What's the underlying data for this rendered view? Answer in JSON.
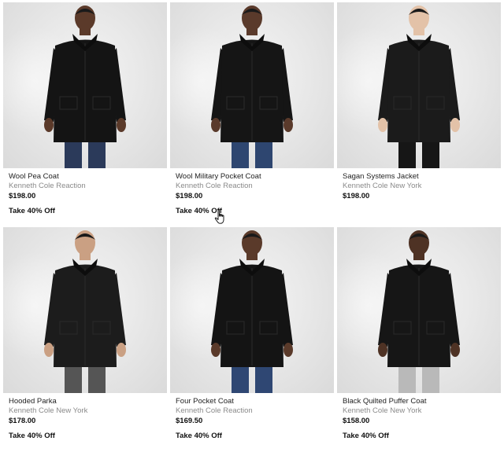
{
  "products": [
    {
      "name": "Wool Pea Coat",
      "brand": "Kenneth Cole Reaction",
      "price": "$198.00",
      "promo": "Take 40% Off",
      "coat_color": "#141414",
      "pants_color": "#2b3a5a",
      "skin": "#5b3a2a"
    },
    {
      "name": "Wool Military Pocket Coat",
      "brand": "Kenneth Cole Reaction",
      "price": "$198.00",
      "promo": "Take 40% Off",
      "coat_color": "#151515",
      "pants_color": "#2e4670",
      "skin": "#5a3a2b"
    },
    {
      "name": "Sagan Systems Jacket",
      "brand": "Kenneth Cole New York",
      "price": "$198.00",
      "promo": "",
      "coat_color": "#1b1b1b",
      "pants_color": "#161616",
      "skin": "#e3c2a8"
    },
    {
      "name": "Hooded Parka",
      "brand": "Kenneth Cole New York",
      "price": "$178.00",
      "promo": "Take 40% Off",
      "coat_color": "#1c1c1c",
      "pants_color": "#555555",
      "skin": "#caa083"
    },
    {
      "name": "Four Pocket Coat",
      "brand": "Kenneth Cole Reaction",
      "price": "$169.50",
      "promo": "Take 40% Off",
      "coat_color": "#141414",
      "pants_color": "#2f4773",
      "skin": "#5a3a2a"
    },
    {
      "name": "Black Quilted Puffer Coat",
      "brand": "Kenneth Cole New York",
      "price": "$158.00",
      "promo": "Take 40% Off",
      "coat_color": "#161616",
      "pants_color": "#b9b9b9",
      "skin": "#4e3224"
    }
  ],
  "cursor_icon": "hand-pointer-icon"
}
